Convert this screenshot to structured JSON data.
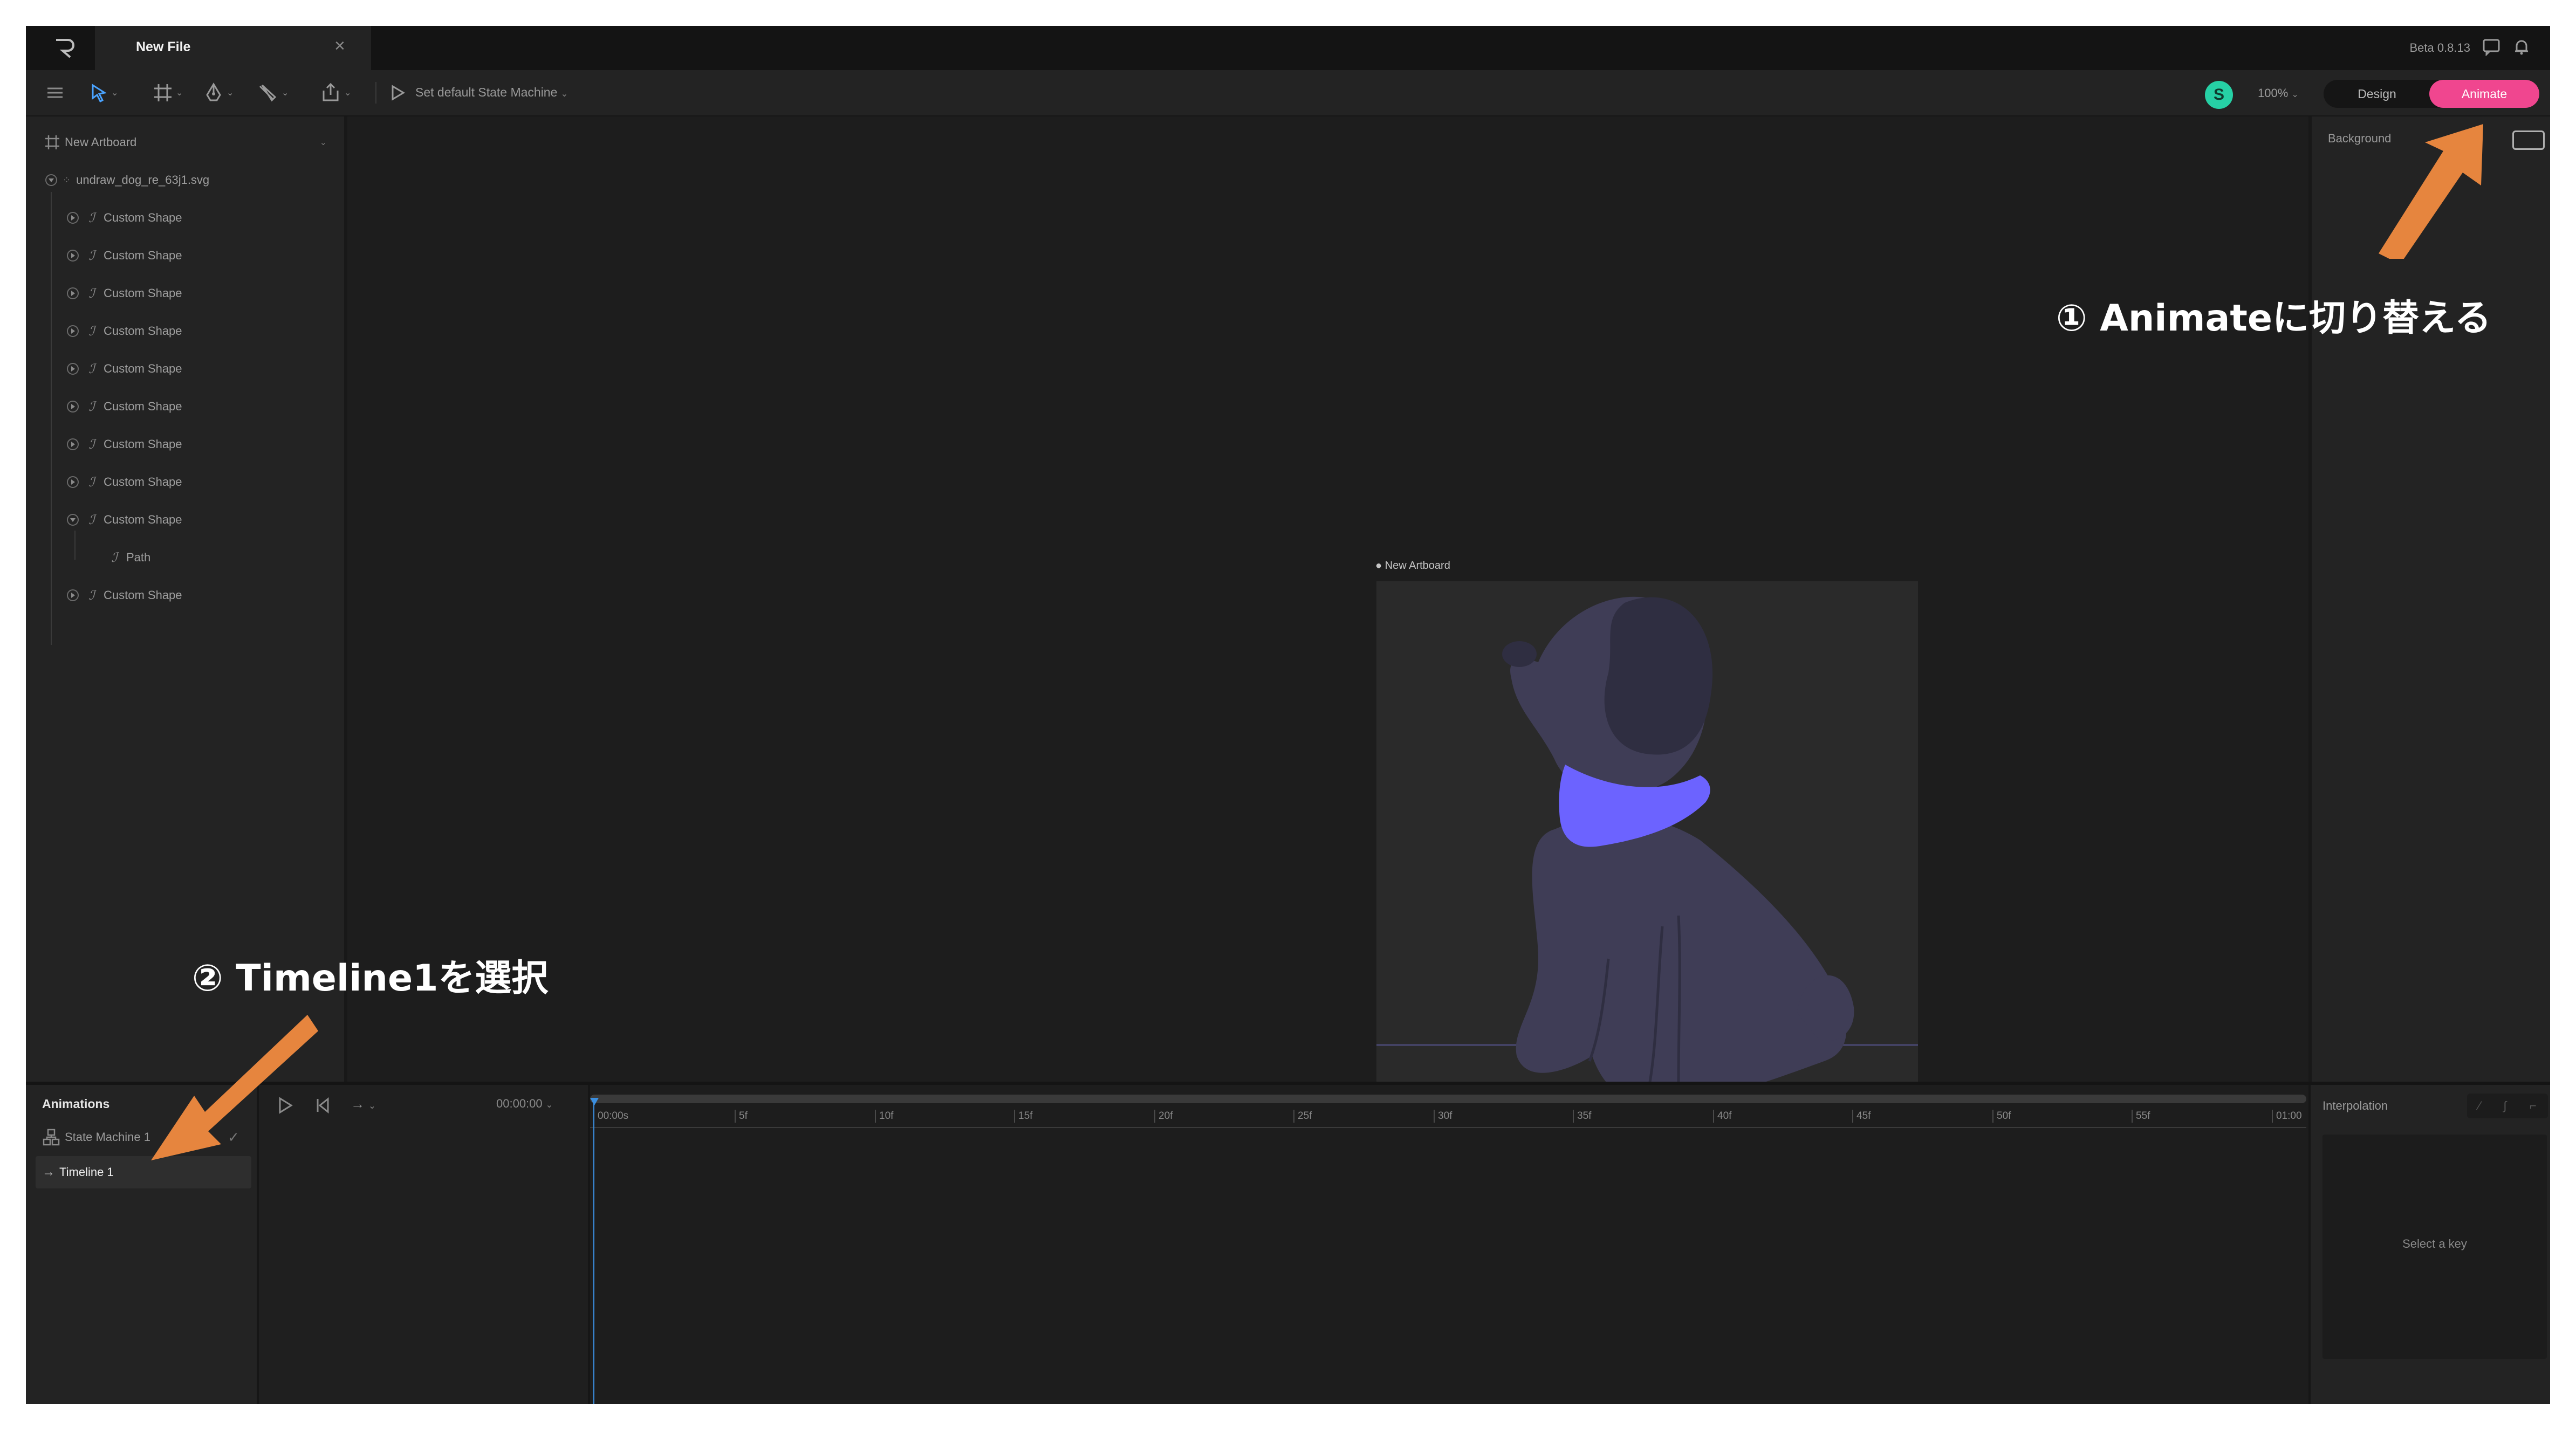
{
  "titlebar": {
    "tab_title": "New File",
    "tab_close": "×",
    "version": "Beta 0.8.13"
  },
  "toolbar": {
    "state_machine_label": "Set default State Machine",
    "avatar_initial": "S",
    "zoom": "100%",
    "mode_design": "Design",
    "mode_animate": "Animate"
  },
  "hierarchy": {
    "artboard": "New Artboard",
    "file": "undraw_dog_re_63j1.svg",
    "shapes": [
      "Custom Shape",
      "Custom Shape",
      "Custom Shape",
      "Custom Shape",
      "Custom Shape",
      "Custom Shape",
      "Custom Shape",
      "Custom Shape",
      "Custom Shape",
      "Custom Shape"
    ],
    "child_path": "Path"
  },
  "canvas": {
    "artboard_label": "New Artboard"
  },
  "inspector": {
    "background_label": "Background"
  },
  "animations": {
    "title": "Animations",
    "state_machine": "State Machine 1",
    "timeline": "Timeline 1"
  },
  "playback": {
    "timecode": "00:00:00"
  },
  "timeline": {
    "ticks": [
      "00:00s",
      "5f",
      "10f",
      "15f",
      "20f",
      "25f",
      "30f",
      "35f",
      "40f",
      "45f",
      "50f",
      "55f",
      "01:00"
    ]
  },
  "interpolation": {
    "title": "Interpolation",
    "empty": "Select a key"
  },
  "annotations": {
    "step1": "① Animateに切り替える",
    "step2": "② Timeline1を選択"
  },
  "colors": {
    "accent_pink": "#f0468f",
    "arrow_orange": "#e6853e",
    "dog_body": "#3f3d56",
    "dog_collar": "#6c63ff",
    "avatar": "#26d0a5"
  }
}
